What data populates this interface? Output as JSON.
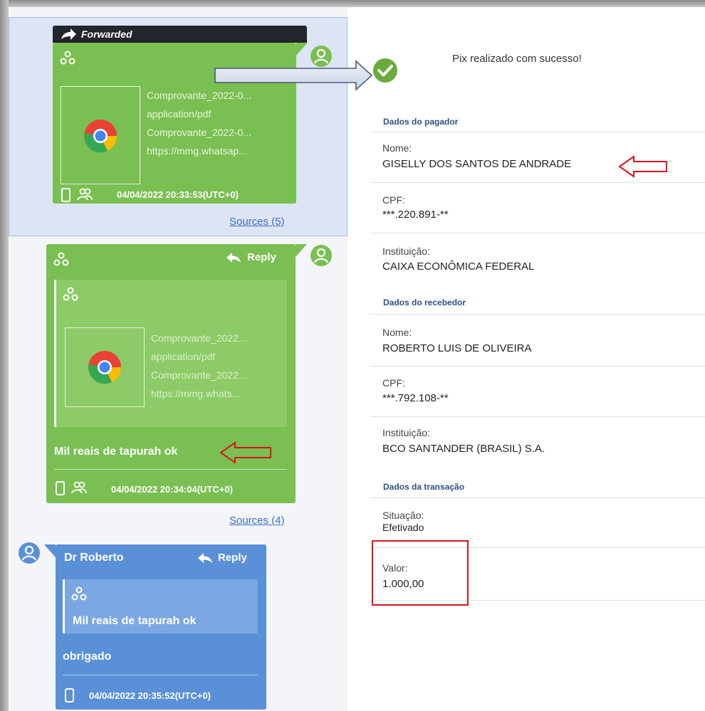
{
  "forwarded_message": {
    "forwarded_label": "Forwarded",
    "attachment_lines": [
      "Comprovante_2022-0...",
      "application/pdf",
      "Comprovante_2022-0...",
      "https://mmg.whatsap..."
    ],
    "timestamp": "04/04/2022 20:33:53(UTC+0)",
    "sources": "Sources (5)"
  },
  "reply_message": {
    "reply_label": "Reply",
    "quoted_attachment_lines": [
      "Comprovante_2022...",
      "application/pdf",
      "Comprovante_2022...",
      "https://mmg.whats..."
    ],
    "text": "Mil reais de tapurah ok",
    "timestamp": "04/04/2022 20:34:04(UTC+0)",
    "sources": "Sources (4)"
  },
  "incoming_message": {
    "sender": "Dr Roberto",
    "reply_label": "Reply",
    "quoted_text": "Mil reais de tapurah ok",
    "text": "obrigado",
    "timestamp": "04/04/2022 20:35:52(UTC+0)"
  },
  "receipt": {
    "status": "Pix realizado com sucesso!",
    "payer_title": "Dados do pagador",
    "payer_name_label": "Nome:",
    "payer_name": "GISELLY DOS SANTOS DE ANDRADE",
    "payer_cpf_label": "CPF:",
    "payer_cpf": "***.220.891-**",
    "payer_inst_label": "Instituição:",
    "payer_inst": "CAIXA ECONÔMICA FEDERAL",
    "receiver_title": "Dados do recebedor",
    "receiver_name_label": "Nome:",
    "receiver_name": "ROBERTO LUIS DE OLIVEIRA",
    "receiver_cpf_label": "CPF:",
    "receiver_cpf": "***.792.108-**",
    "receiver_inst_label": "Instituição:",
    "receiver_inst": "BCO SANTANDER (BRASIL) S.A.",
    "transaction_title": "Dados da transação",
    "status_label": "Situação:",
    "status_value": "Efetivado",
    "amount_label": "Valor:",
    "amount_value": "1.000,00"
  },
  "colors": {
    "outgoing_bubble": "#7abf52",
    "incoming_bubble": "#5a90d8",
    "highlight": "#dde5f5",
    "annotation_red": "#d8141a",
    "section_title": "#2f4f86"
  },
  "icons": [
    "forward-arrow-icon",
    "group-icon",
    "avatar-icon",
    "chrome-icon",
    "phone-device-icon",
    "people-icon",
    "reply-icon",
    "check-circle-icon"
  ]
}
